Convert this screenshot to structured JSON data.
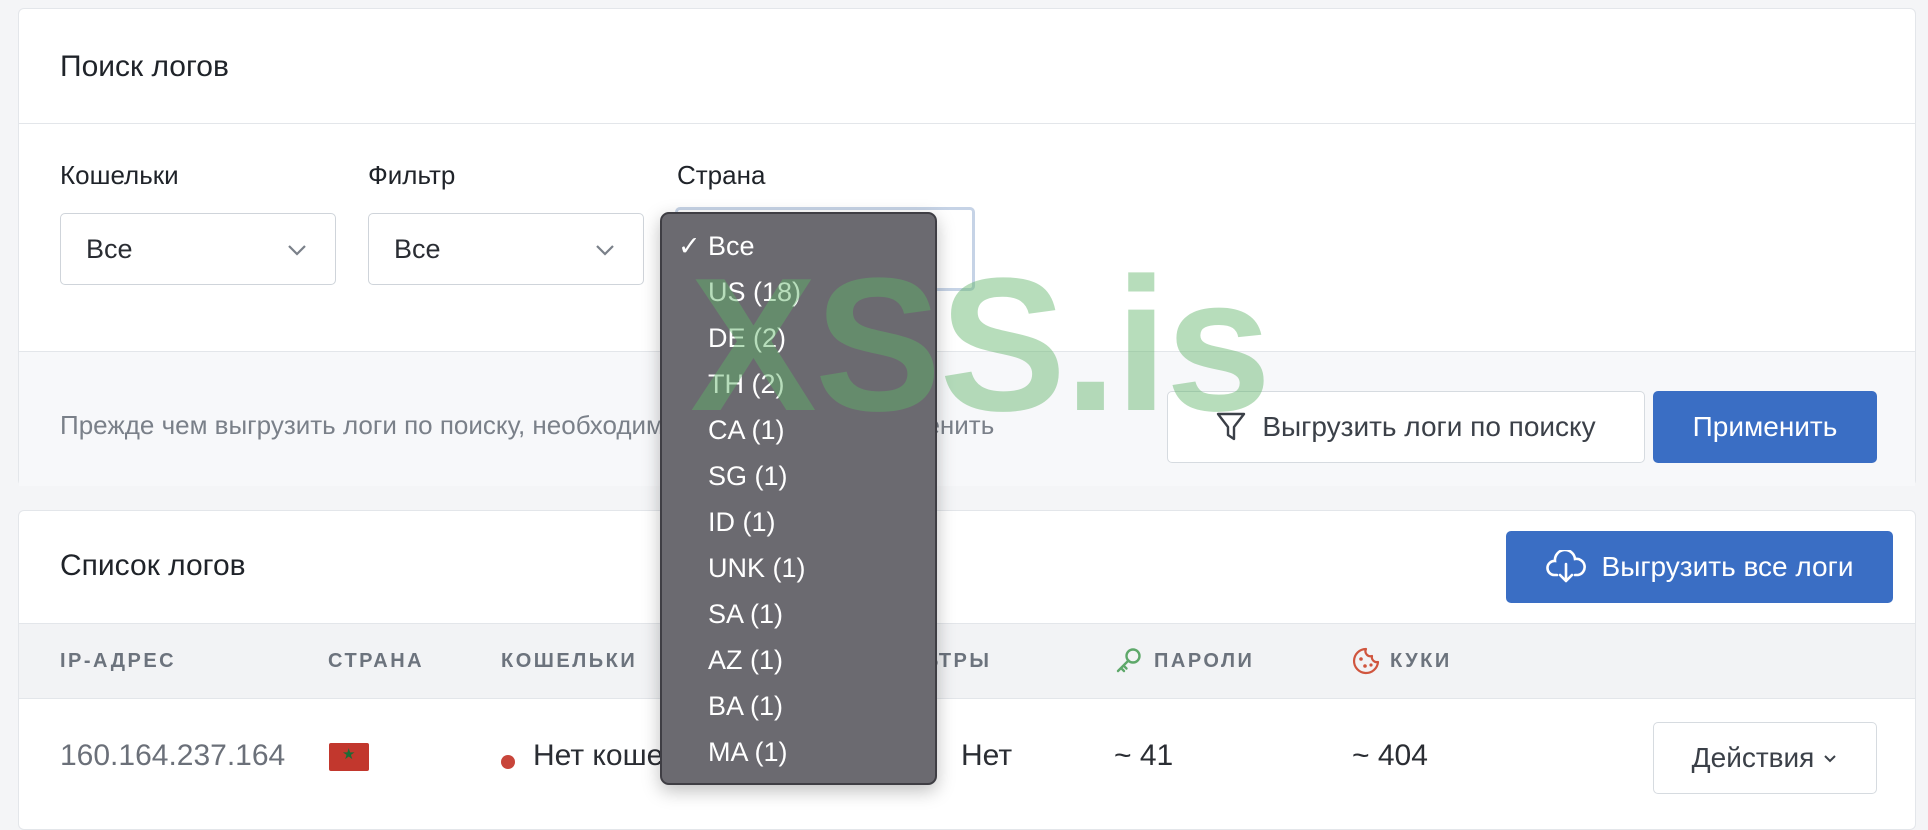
{
  "search": {
    "title": "Поиск логов",
    "wallets": {
      "label": "Кошельки",
      "value": "Все"
    },
    "filter": {
      "label": "Фильтр",
      "value": "Все"
    },
    "country": {
      "label": "Страна",
      "selected": "Все",
      "options": [
        "Все",
        "US (18)",
        "DE (2)",
        "TH (2)",
        "CA (1)",
        "SG (1)",
        "ID (1)",
        "UNK (1)",
        "SA (1)",
        "AZ (1)",
        "BA (1)",
        "MA (1)"
      ]
    },
    "hint": "Прежде чем выгрузить логи по поиску, необходимо нажать кнопку применить",
    "export_search_label": "Выгрузить логи по поиску",
    "apply_label": "Применить"
  },
  "list": {
    "title": "Список логов",
    "export_all_label": "Выгрузить все логи",
    "columns": [
      "IP-АДРЕС",
      "СТРАНА",
      "КОШЕЛЬКИ",
      "ФИЛЬТРЫ",
      "ПАРОЛИ",
      "КУКИ"
    ],
    "rows": [
      {
        "ip": "160.164.237.164",
        "wallets": "Нет кошельков",
        "filters": "Нет",
        "passwords": "~ 41",
        "cookies": "~ 404",
        "actions": "Действия"
      }
    ]
  },
  "watermark": "XSS.is",
  "colors": {
    "primary": "#3a6ec4",
    "dropdown_bg": "#6b6a70",
    "status_dot": "#c8453a",
    "watermark": "#60b468"
  }
}
